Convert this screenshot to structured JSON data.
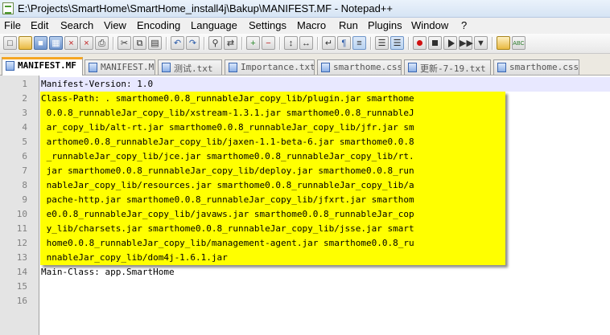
{
  "window": {
    "title": "E:\\Projects\\SmartHome\\SmartHome_install4j\\Bakup\\MANIFEST.MF - Notepad++"
  },
  "menu": [
    "File",
    "Edit",
    "Search",
    "View",
    "Encoding",
    "Language",
    "Settings",
    "Macro",
    "Run",
    "Plugins",
    "Window",
    "?"
  ],
  "toolbar": {
    "icons": [
      "new-file-icon",
      "open-file-icon",
      "save-icon",
      "save-all-icon",
      "close-icon",
      "close-all-icon",
      "print-icon",
      "cut-icon",
      "copy-icon",
      "paste-icon",
      "undo-icon",
      "redo-icon",
      "find-icon",
      "replace-icon",
      "zoom-in-icon",
      "zoom-out-icon",
      "sync-vertical-icon",
      "sync-horizontal-icon",
      "word-wrap-icon",
      "show-all-chars-icon",
      "indent-guide-icon",
      "user-language-icon",
      "function-list-icon",
      "record-macro-icon",
      "stop-record-icon",
      "play-macro-icon",
      "play-multiple-icon",
      "save-macro-icon",
      "plugin-icon",
      "spellcheck-icon"
    ],
    "spellcheck_label": "ABC"
  },
  "tabs": [
    {
      "label": "MANIFEST.MF",
      "active": true
    },
    {
      "label": "MANIFEST.MF",
      "active": false
    },
    {
      "label": "测试.txt",
      "active": false
    },
    {
      "label": "Importance.txt",
      "active": false
    },
    {
      "label": "smarthome.css",
      "active": false
    },
    {
      "label": "更新-7-19.txt",
      "active": false
    },
    {
      "label": "smarthome.css",
      "active": false
    }
  ],
  "editor": {
    "line_numbers": [
      "1",
      "2",
      "3",
      "4",
      "5",
      "6",
      "7",
      "8",
      "9",
      "10",
      "11",
      "12",
      "13",
      "14",
      "15",
      "16"
    ],
    "lines": [
      "Manifest-Version: 1.0",
      "Class-Path: . smarthome0.0.8_runnableJar_copy_lib/plugin.jar smarthome",
      " 0.0.8_runnableJar_copy_lib/xstream-1.3.1.jar smarthome0.0.8_runnableJ",
      " ar_copy_lib/alt-rt.jar smarthome0.0.8_runnableJar_copy_lib/jfr.jar sm",
      " arthome0.0.8_runnableJar_copy_lib/jaxen-1.1-beta-6.jar smarthome0.0.8",
      " _runnableJar_copy_lib/jce.jar smarthome0.0.8_runnableJar_copy_lib/rt.",
      " jar smarthome0.0.8_runnableJar_copy_lib/deploy.jar smarthome0.0.8_run",
      " nableJar_copy_lib/resources.jar smarthome0.0.8_runnableJar_copy_lib/a",
      " pache-http.jar smarthome0.0.8_runnableJar_copy_lib/jfxrt.jar smarthom",
      " e0.0.8_runnableJar_copy_lib/javaws.jar smarthome0.0.8_runnableJar_cop",
      " y_lib/charsets.jar smarthome0.0.8_runnableJar_copy_lib/jsse.jar smart",
      " home0.0.8_runnableJar_copy_lib/management-agent.jar smarthome0.0.8_ru",
      " nnableJar_copy_lib/dom4j-1.6.1.jar",
      "Main-Class: app.SmartHome",
      "",
      ""
    ],
    "highlight_color": "#ffff00",
    "current_line_color": "#e8e8ff"
  }
}
